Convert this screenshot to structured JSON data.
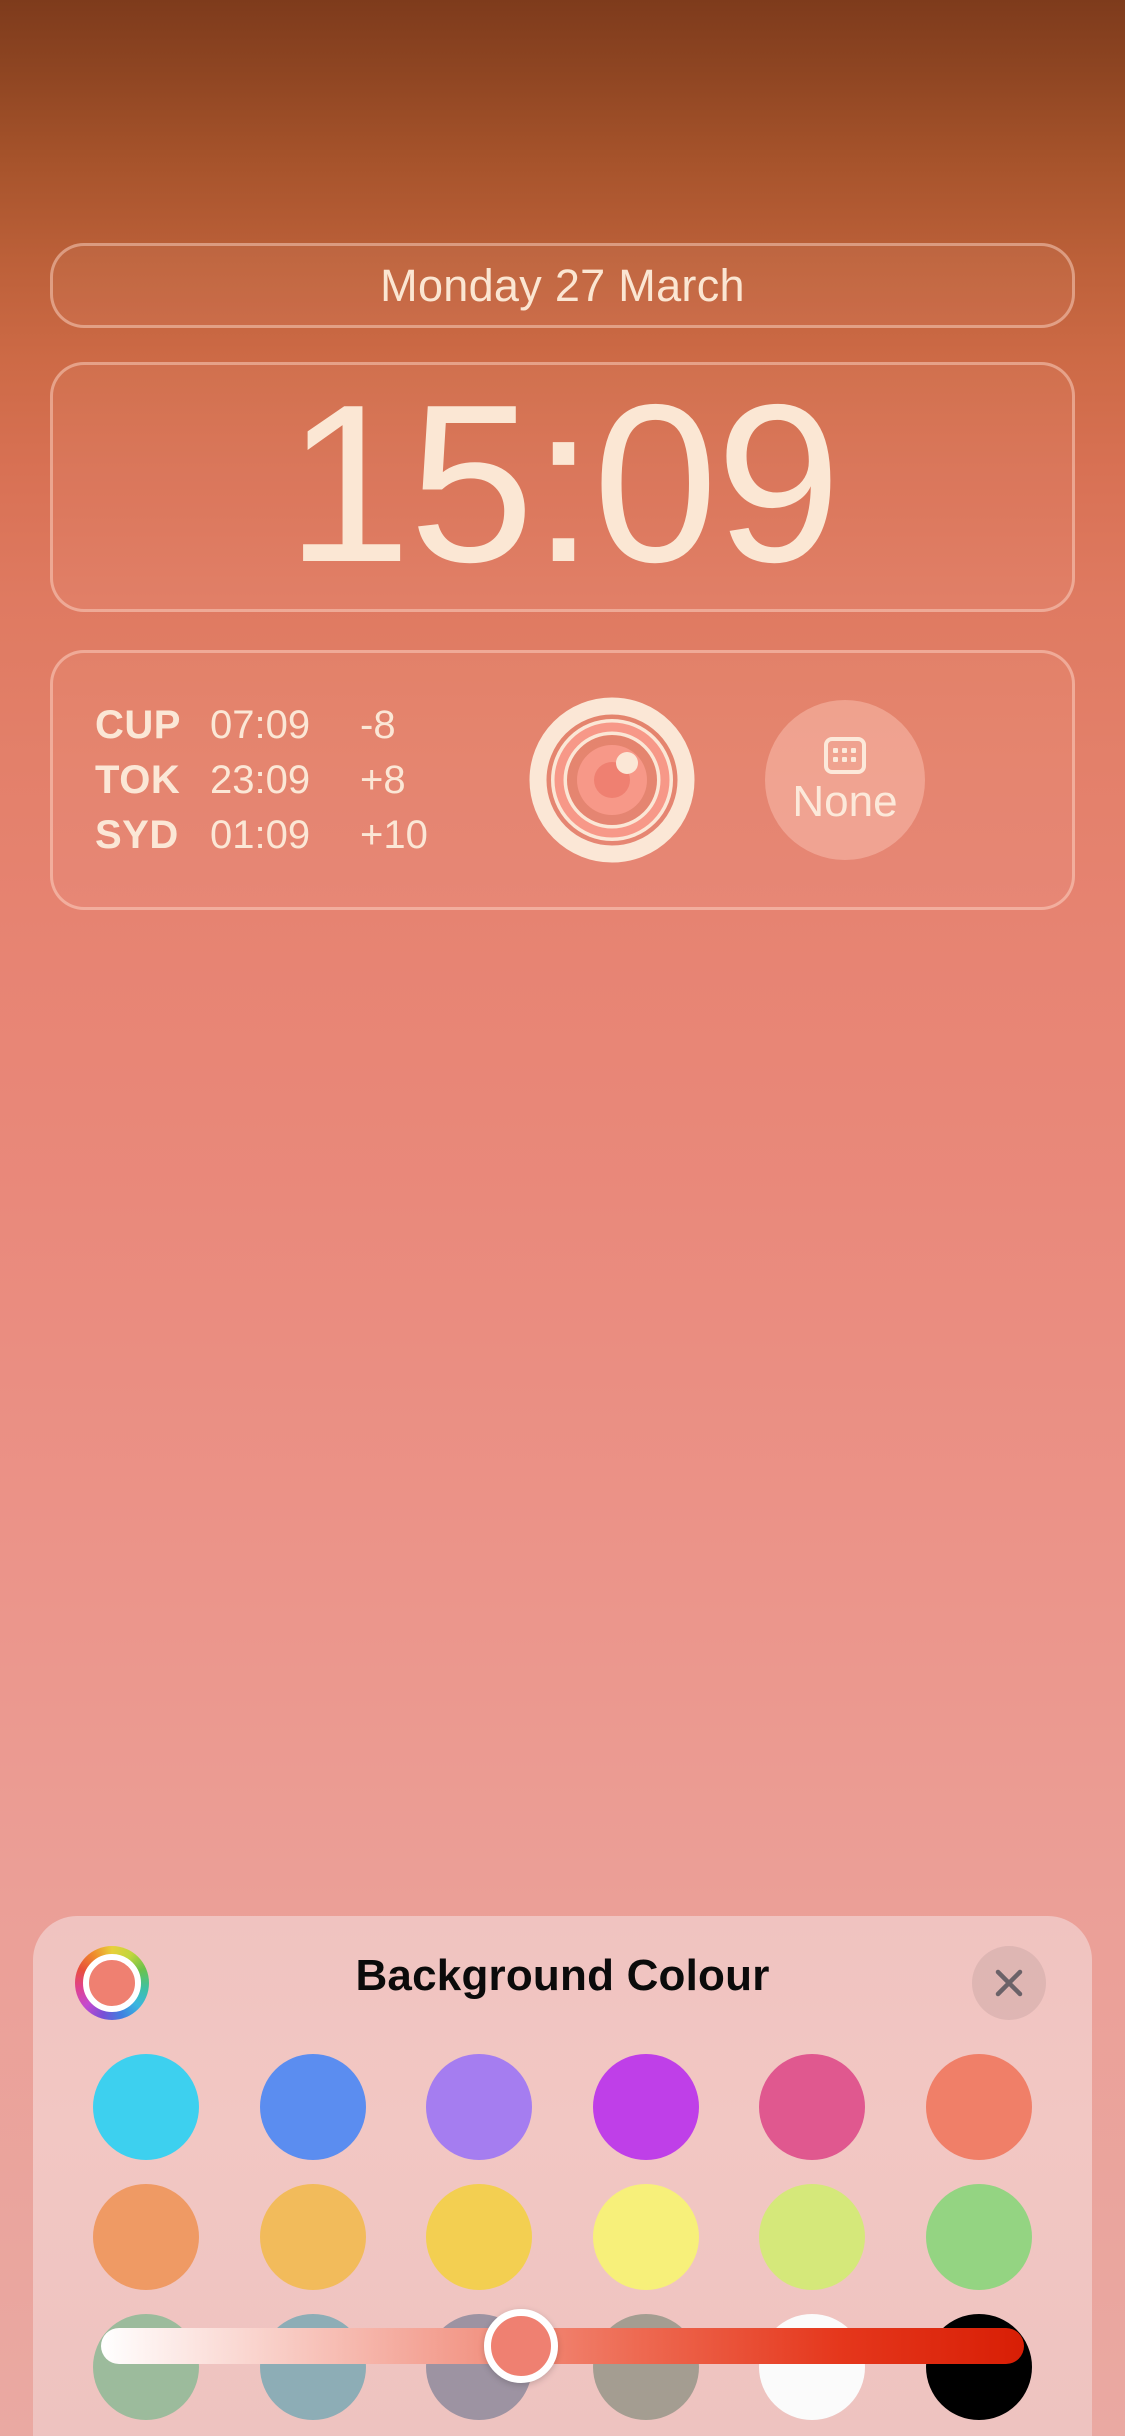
{
  "lockscreen": {
    "date": "Monday 27 March",
    "time": "15:09",
    "world_clock": {
      "rows": [
        {
          "code": "CUP",
          "time": "07:09",
          "offset": "-8"
        },
        {
          "code": "TOK",
          "time": "23:09",
          "offset": "+8"
        },
        {
          "code": "SYD",
          "time": "01:09",
          "offset": "+10"
        }
      ]
    },
    "activity_rings": {
      "icon": "activity-rings-icon"
    },
    "calendar_widget": {
      "icon": "calendar-icon",
      "label": "None"
    },
    "background_colour": "#e78473"
  },
  "sheet": {
    "title": "Background Colour",
    "color_wheel_icon": "colour-wheel-icon",
    "selected_colour": "#ef8071",
    "close_icon": "close-icon",
    "swatch_rows": [
      [
        {
          "name": "cyan",
          "hex": "#3dd0ef"
        },
        {
          "name": "blue",
          "hex": "#5b8df0"
        },
        {
          "name": "violet",
          "hex": "#a57df0"
        },
        {
          "name": "magenta",
          "hex": "#bf3fe8"
        },
        {
          "name": "pink",
          "hex": "#e0588f"
        },
        {
          "name": "salmon",
          "hex": "#f07f68"
        }
      ],
      [
        {
          "name": "orange",
          "hex": "#ef9a64"
        },
        {
          "name": "amber",
          "hex": "#f2bb5b"
        },
        {
          "name": "yellow",
          "hex": "#f3cf51"
        },
        {
          "name": "light-yellow",
          "hex": "#f7f07a"
        },
        {
          "name": "lime",
          "hex": "#d5e87a"
        },
        {
          "name": "green",
          "hex": "#94d482"
        }
      ],
      [
        {
          "name": "sage",
          "hex": "#9cbb9c"
        },
        {
          "name": "slate-blue",
          "hex": "#8dadb6"
        },
        {
          "name": "mauve",
          "hex": "#9d93a2"
        },
        {
          "name": "taupe",
          "hex": "#a49d91"
        },
        {
          "name": "white",
          "hex": "#fbfbfb"
        },
        {
          "name": "black",
          "hex": "#000000"
        }
      ]
    ],
    "slider": {
      "name": "brightness-slider",
      "thumb_colour": "#ef8071",
      "position_percent": 45.5
    }
  }
}
